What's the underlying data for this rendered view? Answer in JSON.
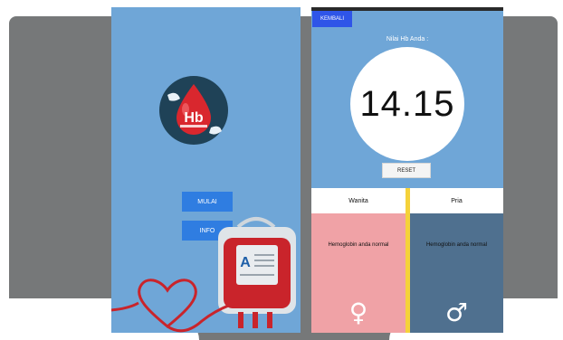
{
  "left_screen": {
    "logo_text": "Hb",
    "buttons": [
      {
        "label": "MULAI"
      },
      {
        "label": "INFO"
      }
    ],
    "bag_letter": "A"
  },
  "right_screen": {
    "back_label": "KEMBALI",
    "result_title": "Nilai Hb Anda :",
    "result_value": "14.15",
    "reset_label": "RESET",
    "genders": [
      {
        "label": "Wanita",
        "status": "Hemoglobin anda normal",
        "icon": "female-symbol-icon",
        "symbol": "♀",
        "color": "#f0a2a6"
      },
      {
        "label": "Pria",
        "status": "Hemoglobin anda normal",
        "icon": "male-symbol-icon",
        "symbol": "♂",
        "color": "#4f708f"
      }
    ]
  },
  "colors": {
    "screen_bg": "#6fa6d7",
    "button_blue": "#2f7de1",
    "divider_yellow": "#f5d23a",
    "frame_gray": "#767879"
  }
}
